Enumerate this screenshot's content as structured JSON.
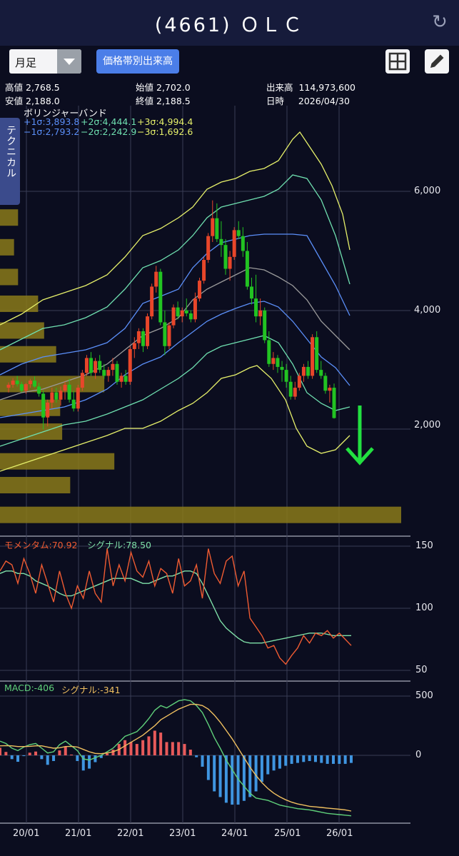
{
  "header": {
    "title": "(4661) ＯＬＣ"
  },
  "toolbar": {
    "period": "月足",
    "volume_profile_button": "価格帯別出来高"
  },
  "quote": {
    "high_label": "高値",
    "high": "2,768.5",
    "low_label": "安値",
    "low": "2,188.0",
    "open_label": "始値",
    "open": "2,702.0",
    "close_label": "終値",
    "close": "2,188.5",
    "volume_label": "出来高",
    "volume": "114,973,600",
    "date_label": "日時",
    "date": "2026/04/30"
  },
  "technical_tab": "テクニカル",
  "bollinger": {
    "title": "ボリンジャーバンド",
    "p1": "+1σ:3,893.8",
    "p2": "+2σ:4,444.1",
    "p3": "+3σ:4,994.4",
    "m1": "−1σ:2,793.2",
    "m2": "−2σ:2,242.9",
    "m3": "−3σ:1,692.6"
  },
  "momentum": {
    "label": "モメンタム:70.92",
    "signal": "シグナル:78.50"
  },
  "macd": {
    "label": "MACD:-406",
    "signal": "シグナル:-341"
  },
  "colors": {
    "up": "#e8462a",
    "down": "#22c322",
    "sigma1": "#5b8ff9",
    "sigma2": "#6fe0b0",
    "sigma3": "#e6f06a",
    "middle": "#9a9a9a",
    "momentum": "#ef5b32",
    "momentum_signal": "#7fe0a8",
    "macd": "#5fd07a",
    "macd_signal": "#f0c060",
    "hist_pos": "#e85a5a",
    "hist_neg": "#3f95e0",
    "volume_profile": "#8a7a1a",
    "arrow": "#22e040"
  },
  "chart_data": [
    {
      "type": "candlestick",
      "title": "ボリンジャーバンド",
      "x_ticks": [
        "20/01",
        "21/01",
        "22/01",
        "23/01",
        "24/01",
        "25/01",
        "26/01"
      ],
      "y_ticks": [
        "2,000",
        "4,000",
        "6,000"
      ],
      "ylim": [
        0,
        7500
      ],
      "months_start": "2019-04",
      "candles": [
        [
          2700,
          2790,
          2620,
          2750
        ],
        [
          2750,
          2860,
          2700,
          2820
        ],
        [
          2820,
          2900,
          2720,
          2760
        ],
        [
          2760,
          2800,
          2620,
          2650
        ],
        [
          2650,
          2780,
          2600,
          2760
        ],
        [
          2760,
          2850,
          2700,
          2820
        ],
        [
          2820,
          2890,
          2700,
          2720
        ],
        [
          2720,
          2780,
          2550,
          2600
        ],
        [
          2600,
          2650,
          2000,
          2200
        ],
        [
          2200,
          2500,
          2050,
          2450
        ],
        [
          2450,
          2700,
          2350,
          2620
        ],
        [
          2620,
          2700,
          2450,
          2500
        ],
        [
          2500,
          2720,
          2400,
          2650
        ],
        [
          2650,
          2800,
          2500,
          2750
        ],
        [
          2750,
          2850,
          2450,
          2500
        ],
        [
          2500,
          2650,
          2300,
          2350
        ],
        [
          2350,
          2750,
          2300,
          2700
        ],
        [
          2700,
          3000,
          2650,
          2950
        ],
        [
          2950,
          3250,
          2900,
          3200
        ],
        [
          3200,
          3300,
          2900,
          2950
        ],
        [
          2950,
          3200,
          2850,
          3150
        ],
        [
          3150,
          3250,
          2950,
          3000
        ],
        [
          3000,
          3100,
          2850,
          2900
        ],
        [
          2900,
          3050,
          2800,
          3000
        ],
        [
          3000,
          3200,
          2900,
          3100
        ],
        [
          3100,
          3150,
          2750,
          2800
        ],
        [
          2800,
          2950,
          2700,
          2900
        ],
        [
          2900,
          3000,
          2750,
          2800
        ],
        [
          2800,
          3400,
          2750,
          3350
        ],
        [
          3350,
          3550,
          3200,
          3450
        ],
        [
          3450,
          3700,
          3350,
          3650
        ],
        [
          3650,
          3700,
          3300,
          3400
        ],
        [
          3400,
          3950,
          3350,
          3900
        ],
        [
          3900,
          4450,
          3850,
          4400
        ],
        [
          4400,
          4750,
          4300,
          4650
        ],
        [
          4650,
          4700,
          3750,
          3800
        ],
        [
          3800,
          4000,
          3250,
          3400
        ],
        [
          3400,
          3800,
          3350,
          3750
        ],
        [
          3750,
          4100,
          3700,
          4050
        ],
        [
          4050,
          4150,
          3850,
          3900
        ],
        [
          3900,
          4050,
          3800,
          4000
        ],
        [
          4000,
          4200,
          3900,
          3950
        ],
        [
          3950,
          4000,
          3800,
          3850
        ],
        [
          3850,
          4300,
          3800,
          4200
        ],
        [
          4200,
          4550,
          4150,
          4500
        ],
        [
          4500,
          4900,
          4450,
          4850
        ],
        [
          4850,
          5300,
          4800,
          5250
        ],
        [
          5250,
          5850,
          5150,
          5550
        ],
        [
          5550,
          5800,
          5150,
          5200
        ],
        [
          5200,
          5500,
          4900,
          5100
        ],
        [
          5100,
          5200,
          4600,
          4700
        ],
        [
          4700,
          5000,
          4500,
          4900
        ],
        [
          4900,
          5400,
          4850,
          5350
        ],
        [
          5350,
          5500,
          5200,
          5250
        ],
        [
          5250,
          5400,
          4900,
          5000
        ],
        [
          5000,
          5150,
          4350,
          4400
        ],
        [
          4400,
          4550,
          4100,
          4200
        ],
        [
          4200,
          4600,
          3800,
          3900
        ],
        [
          3900,
          4200,
          3750,
          4000
        ],
        [
          4000,
          4050,
          3450,
          3500
        ],
        [
          3500,
          3650,
          3050,
          3100
        ],
        [
          3100,
          3300,
          3000,
          3200
        ],
        [
          3200,
          3250,
          2950,
          3050
        ],
        [
          3050,
          3150,
          2800,
          3000
        ],
        [
          3000,
          3100,
          2700,
          2800
        ],
        [
          2800,
          2900,
          2500,
          2550
        ],
        [
          2550,
          2800,
          2500,
          2700
        ],
        [
          2700,
          2950,
          2650,
          2900
        ],
        [
          2900,
          3100,
          2800,
          3050
        ],
        [
          3050,
          3150,
          2850,
          2900
        ],
        [
          2900,
          3600,
          2850,
          3550
        ],
        [
          3550,
          3650,
          2950,
          3000
        ],
        [
          3000,
          3150,
          2850,
          2900
        ],
        [
          2900,
          2950,
          2600,
          2650
        ],
        [
          2650,
          2750,
          2450,
          2700
        ],
        [
          2700,
          2770,
          2180,
          2190
        ]
      ],
      "bands": {
        "middle": [
          2900,
          2950,
          2900,
          2880,
          2870,
          2850,
          2880,
          2950,
          3000,
          3100,
          3150,
          3200,
          3250,
          3300,
          3350,
          3400,
          3450,
          3550,
          3650,
          3800,
          3950,
          4050,
          4150,
          4300,
          4400,
          4500,
          4600,
          4700,
          4800,
          4850,
          4800,
          4700,
          4600,
          4500,
          4400,
          4250,
          4100,
          3950,
          3800,
          3650,
          3500,
          3350
        ],
        "s1": [
          2750,
          2700,
          2650,
          2600,
          2620,
          2700,
          2800,
          2950,
          3050,
          3200,
          3300,
          3400,
          3500,
          3650,
          3800,
          3950,
          4050,
          4200,
          4400,
          4600,
          4800,
          5000,
          5150,
          5250,
          5250,
          5280,
          5300,
          5300,
          5250,
          5100,
          4900,
          4600,
          4300,
          4000,
          3700,
          3400,
          3050
        ],
        "note": "bands drawn via script"
      },
      "volume_profile": [
        {
          "price_top": 5700,
          "price_bottom": 5400,
          "length": 0.045
        },
        {
          "price_top": 5200,
          "price_bottom": 4900,
          "length": 0.035
        },
        {
          "price_top": 4700,
          "price_bottom": 4400,
          "length": 0.045
        },
        {
          "price_top": 4250,
          "price_bottom": 3950,
          "length": 0.095
        },
        {
          "price_top": 3800,
          "price_bottom": 3500,
          "length": 0.11
        },
        {
          "price_top": 3400,
          "price_bottom": 3100,
          "length": 0.14
        },
        {
          "price_top": 2900,
          "price_bottom": 2600,
          "length": 0.26
        },
        {
          "price_top": 2500,
          "price_bottom": 2200,
          "length": 0.15
        },
        {
          "price_top": 2100,
          "price_bottom": 1800,
          "length": 0.155
        },
        {
          "price_top": 1600,
          "price_bottom": 1300,
          "length": 0.285
        },
        {
          "price_top": 1200,
          "price_bottom": 900,
          "length": 0.175
        },
        {
          "price_top": 700,
          "price_bottom": 400,
          "length": 1.0
        }
      ]
    },
    {
      "type": "line",
      "title": "モメンタム",
      "y_ticks": [
        "150",
        "100",
        "50"
      ],
      "ylim": [
        45,
        155
      ],
      "series": [
        {
          "name": "モメンタム",
          "values": [
            130,
            138,
            135,
            120,
            140,
            128,
            112,
            135,
            120,
            105,
            130,
            112,
            100,
            118,
            108,
            130,
            112,
            105,
            148,
            118,
            135,
            122,
            145,
            130,
            125,
            138,
            118,
            132,
            128,
            112,
            140,
            118,
            122,
            135,
            108,
            148,
            128,
            120,
            138,
            142,
            118,
            130,
            92,
            85,
            78,
            68,
            70,
            60,
            55,
            62,
            68,
            78,
            72,
            80,
            78,
            82,
            76,
            80,
            75,
            70
          ]
        },
        {
          "name": "シグナル",
          "values": [
            128,
            130,
            130,
            128,
            128,
            126,
            122,
            120,
            118,
            115,
            112,
            110,
            110,
            112,
            114,
            116,
            118,
            120,
            122,
            124,
            124,
            124,
            124,
            122,
            120,
            120,
            122,
            124,
            126,
            126,
            128,
            130,
            130,
            128,
            120,
            110,
            100,
            90,
            84,
            80,
            76,
            73,
            72,
            72,
            72,
            73,
            74,
            75,
            76,
            77,
            78,
            79,
            80,
            80,
            80,
            79,
            78,
            78,
            78,
            78
          ]
        }
      ]
    },
    {
      "type": "line",
      "title": "MACD",
      "y_ticks": [
        "500",
        "0"
      ],
      "ylim": [
        -520,
        560
      ],
      "series": [
        {
          "name": "MACD",
          "values": [
            120,
            100,
            60,
            40,
            70,
            90,
            100,
            60,
            20,
            30,
            90,
            120,
            80,
            40,
            -30,
            -40,
            -20,
            0,
            30,
            60,
            110,
            160,
            180,
            200,
            250,
            310,
            380,
            420,
            400,
            430,
            460,
            470,
            460,
            420,
            360,
            260,
            150,
            60,
            -40,
            -120,
            -200,
            -260,
            -320,
            -360,
            -370,
            -380,
            -400,
            -420,
            -430,
            -440,
            -450,
            -455,
            -460,
            -470,
            -480,
            -490,
            -495,
            -500,
            -505,
            -510
          ]
        },
        {
          "name": "シグナル",
          "values": [
            80,
            82,
            80,
            74,
            74,
            76,
            80,
            80,
            70,
            60,
            64,
            74,
            76,
            70,
            50,
            30,
            16,
            14,
            20,
            30,
            50,
            80,
            110,
            140,
            170,
            210,
            250,
            300,
            330,
            360,
            390,
            410,
            430,
            430,
            420,
            390,
            340,
            280,
            210,
            140,
            60,
            -20,
            -100,
            -170,
            -230,
            -280,
            -320,
            -350,
            -375,
            -395,
            -410,
            -420,
            -430,
            -435,
            -440,
            -445,
            -450,
            -455,
            -460,
            -470
          ]
        }
      ]
    }
  ]
}
